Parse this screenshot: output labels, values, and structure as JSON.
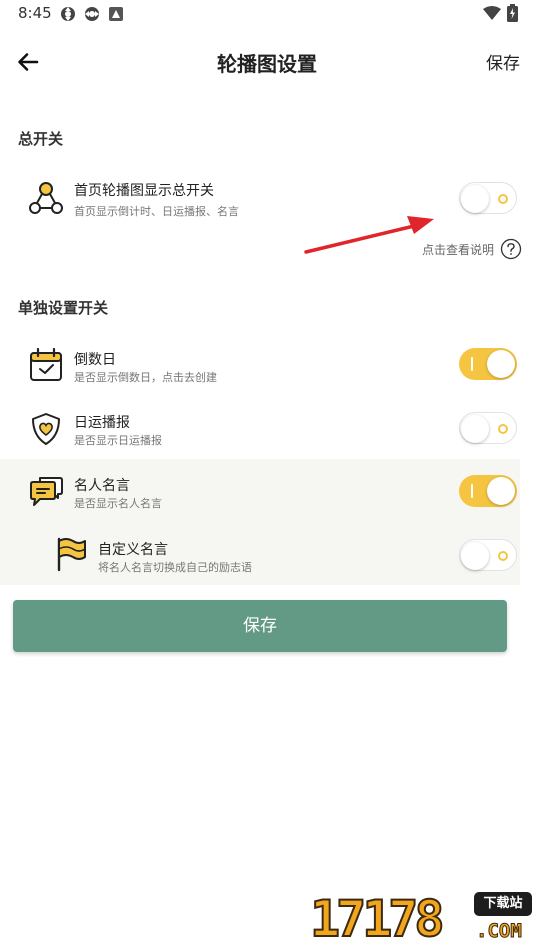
{
  "status_bar": {
    "time": "8:45",
    "icons": [
      "sync-icon",
      "sync-icon",
      "app-icon",
      "wifi-icon",
      "battery-icon"
    ]
  },
  "header": {
    "back_icon": "arrow-left-icon",
    "title": "轮播图设置",
    "save_label": "保存"
  },
  "master": {
    "section_title": "总开关",
    "row": {
      "icon": "network-icon",
      "title": "首页轮播图显示总开关",
      "desc": "首页显示倒计时、日运播报、名言",
      "enabled": false
    },
    "help_text": "点击查看说明",
    "help_icon": "question-circle-icon"
  },
  "individual": {
    "section_title": "单独设置开关",
    "rows": [
      {
        "icon": "calendar-check-icon",
        "title": "倒数日",
        "desc": "是否显示倒数日，点击去创建",
        "enabled": true
      },
      {
        "icon": "shield-heart-icon",
        "title": "日运播报",
        "desc": "是否显示日运播报",
        "enabled": false
      },
      {
        "icon": "chat-bubbles-icon",
        "title": "名人名言",
        "desc": "是否显示名人名言",
        "enabled": true
      },
      {
        "icon": "flag-icon",
        "title": "自定义名言",
        "desc": "将名人名言切换成自己的励志语",
        "enabled": false
      }
    ]
  },
  "save_button": {
    "label": "保存"
  },
  "watermark": {
    "digits": "17178",
    "badge": "下载站",
    "suffix": ".COM"
  },
  "colors": {
    "accent_yellow": "#f5c542",
    "save_green": "#629a86",
    "highlight_bg": "#f6f6f2",
    "annotation_red": "#e0262a"
  }
}
